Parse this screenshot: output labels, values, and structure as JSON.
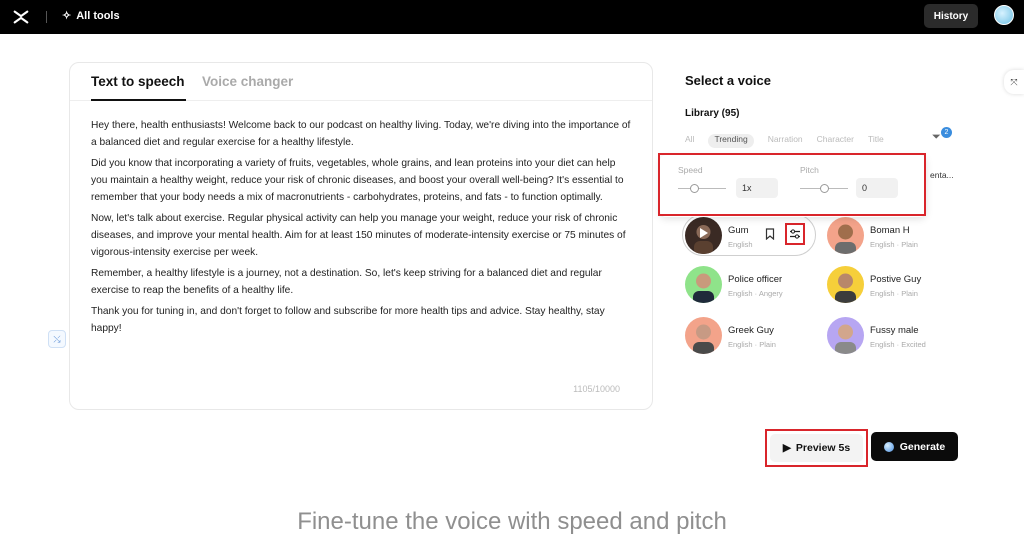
{
  "topbar": {
    "alltools_label": "All tools",
    "history_label": "History"
  },
  "editor": {
    "tabs": [
      {
        "label": "Text to speech",
        "active": true
      },
      {
        "label": "Voice changer",
        "active": false
      }
    ],
    "paragraphs": [
      "Hey there, health enthusiasts! Welcome back to our podcast on healthy living. Today, we're diving into the importance of a balanced diet and regular exercise for a healthy lifestyle.",
      "Did you know that incorporating a variety of fruits, vegetables, whole grains, and lean proteins into your diet can help you maintain a healthy weight, reduce your risk of chronic diseases, and boost your overall well-being? It's essential to remember that your body needs a mix of macronutrients - carbohydrates, proteins, and fats - to function optimally.",
      "Now, let's talk about exercise. Regular physical activity can help you manage your weight, reduce your risk of chronic diseases, and improve your mental health. Aim for at least 150 minutes of moderate-intensity exercise or 75 minutes of vigorous-intensity exercise per week.",
      "Remember, a healthy lifestyle is a journey, not a destination. So, let's keep striving for a balanced diet and regular exercise to reap the benefits of a healthy life.",
      "Thank you for tuning in, and don't forget to follow and subscribe for more health tips and advice. Stay healthy, stay happy!"
    ],
    "char_count": "1105/10000"
  },
  "voice_panel": {
    "title": "Select a voice",
    "library_label": "Library (95)",
    "filters": [
      "All",
      "Trending",
      "Narration",
      "Character",
      "Title"
    ],
    "filter_badge": "2",
    "partial_name": "enta...",
    "settings": {
      "speed_label": "Speed",
      "speed_value": "1x",
      "speed_level": 0.35,
      "pitch_label": "Pitch",
      "pitch_value": "0",
      "pitch_level": 0.5
    },
    "voices": [
      {
        "name": "Gum",
        "meta": "English",
        "selected": true,
        "bg": "#d8b8a8"
      },
      {
        "name": "Boman H",
        "meta": "English · Plain",
        "selected": false,
        "bg": "#f3a38a"
      },
      {
        "name": "Police officer",
        "meta": "English · Angery",
        "selected": false,
        "bg": "#8fe38a"
      },
      {
        "name": "Postive Guy",
        "meta": "English · Plain",
        "selected": false,
        "bg": "#f6cf3a"
      },
      {
        "name": "Greek Guy",
        "meta": "English · Plain",
        "selected": false,
        "bg": "#f3a38a"
      },
      {
        "name": "Fussy male",
        "meta": "English · Excited",
        "selected": false,
        "bg": "#b7a6f2"
      }
    ]
  },
  "actions": {
    "preview_label": "Preview 5s",
    "generate_label": "Generate"
  },
  "caption": "Fine-tune the voice with speed and pitch",
  "colors": {
    "highlight": "#d9252b",
    "topbar": "#000000",
    "generate_bg": "#0b0b0b"
  }
}
